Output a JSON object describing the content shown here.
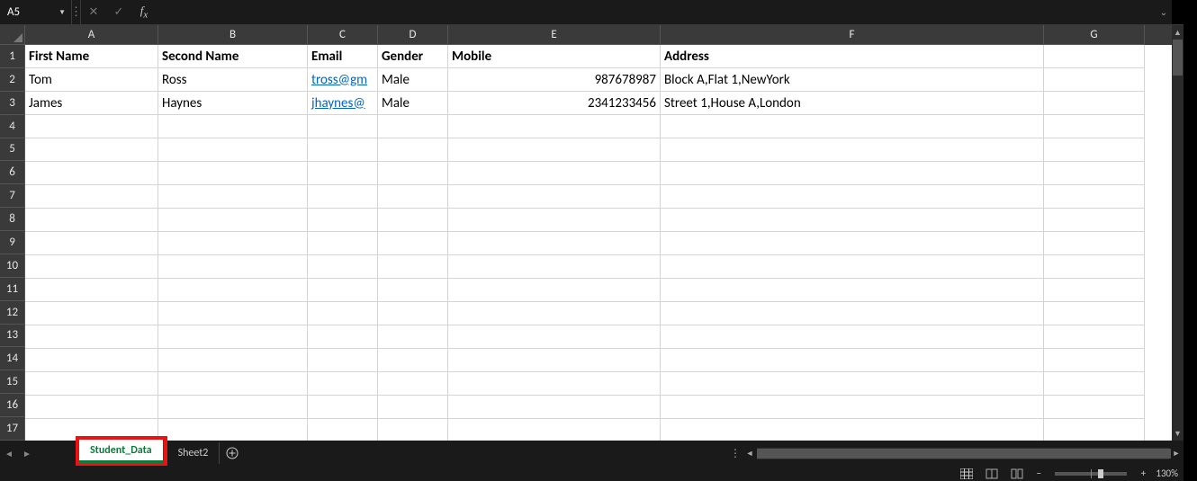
{
  "nameBox": {
    "value": "A5"
  },
  "formula": {
    "value": ""
  },
  "columns": [
    "A",
    "B",
    "C",
    "D",
    "E",
    "F",
    "G"
  ],
  "rowCount": 17,
  "headers": {
    "A": "First Name",
    "B": "Second Name",
    "C": "Email",
    "D": "Gender",
    "E": "Mobile",
    "F": "Address"
  },
  "rows": [
    {
      "A": "Tom",
      "B": "Ross",
      "C": "tross@gm",
      "D": "Male",
      "E": "987678987",
      "F": "Block A,Flat 1,NewYork"
    },
    {
      "A": "James",
      "B": "Haynes",
      "C": "jhaynes@",
      "D": "Male",
      "E": "2341233456",
      "F": "Street 1,House A,London"
    }
  ],
  "sheets": {
    "active": "Student_Data",
    "other": "Sheet2"
  },
  "zoom": {
    "label": "130%"
  }
}
